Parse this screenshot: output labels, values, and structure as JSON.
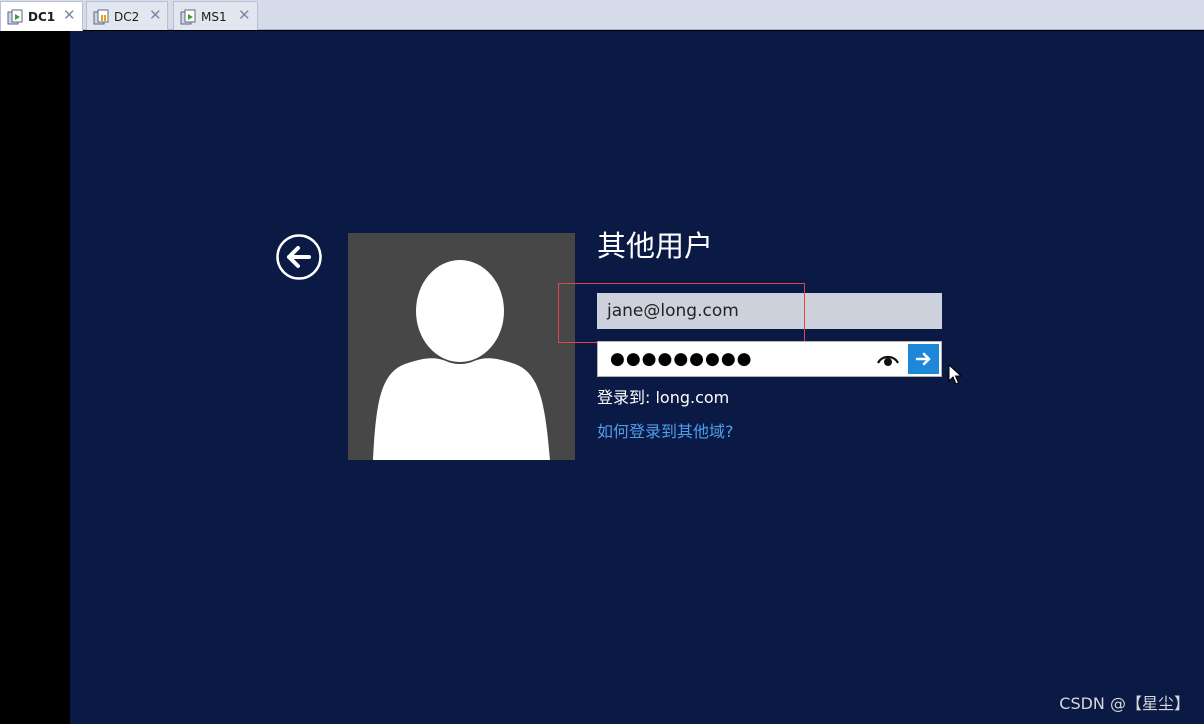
{
  "tabs": [
    {
      "label": "DC1",
      "active": true,
      "icon": "vm-server-icon"
    },
    {
      "label": "DC2",
      "active": false,
      "icon": "vm-server-icon"
    },
    {
      "label": "MS1",
      "active": false,
      "icon": "vm-server-icon"
    }
  ],
  "tab_close_glyph": "✕",
  "login": {
    "title": "其他用户",
    "username_value": "jane@long.com",
    "password_masked": "●●●●●●●●●",
    "domain_text": "登录到: long.com",
    "other_domain_link": "如何登录到其他域?"
  },
  "watermark": "CSDN @【星尘】",
  "colors": {
    "screen_background": "#0a1a45",
    "avatar_background": "#474747",
    "submit_button": "#1e88d8",
    "link": "#4f9dea",
    "highlight_box": "#e0454a"
  },
  "icons": {
    "back": "back-arrow-circle-icon",
    "reveal": "eye-icon",
    "submit": "arrow-right-icon",
    "avatar": "user-silhouette-icon"
  }
}
